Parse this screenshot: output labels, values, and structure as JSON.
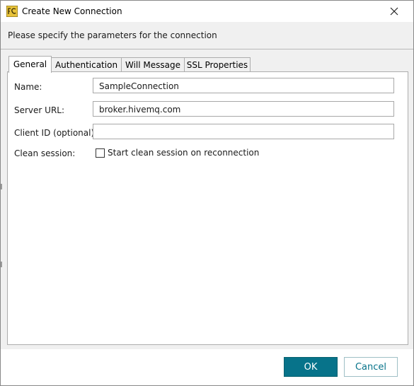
{
  "window": {
    "title": "Create New Connection",
    "header_text": "Please specify the parameters for the connection"
  },
  "tabs": [
    {
      "label": "General",
      "active": true
    },
    {
      "label": "Authentication",
      "active": false
    },
    {
      "label": "Will Message",
      "active": false
    },
    {
      "label": "SSL Properties",
      "active": false
    }
  ],
  "form": {
    "name_label": "Name:",
    "name_value": "SampleConnection",
    "server_label": "Server URL:",
    "server_value": "broker.hivemq.com",
    "client_label": "Client ID (optional):",
    "client_value": "",
    "clean_label": "Clean session:",
    "clean_checkbox_label": "Start clean session on reconnection",
    "clean_checked": false
  },
  "buttons": {
    "ok": "OK",
    "cancel": "Cancel"
  },
  "colors": {
    "accent": "#07738a",
    "app_icon": "#e8c33a"
  },
  "icons": {
    "app": "app-logo-icon",
    "close": "close-icon"
  }
}
